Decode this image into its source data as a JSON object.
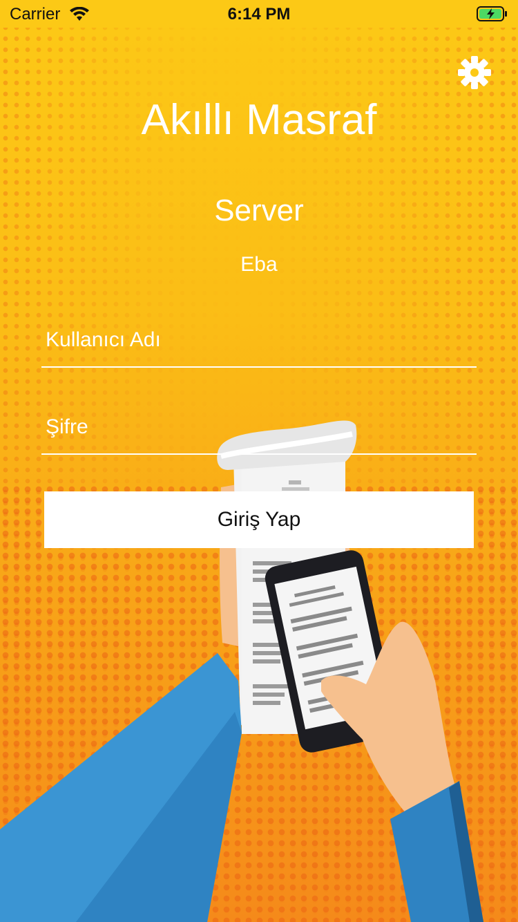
{
  "status_bar": {
    "carrier": "Carrier",
    "time": "6:14 PM",
    "wifi_icon": "wifi-icon",
    "battery_icon": "battery-charging-icon"
  },
  "header": {
    "settings_icon": "gear-icon",
    "app_title": "Akıllı Masraf"
  },
  "server": {
    "label": "Server",
    "name": "Eba"
  },
  "form": {
    "username_placeholder": "Kullanıcı Adı",
    "password_placeholder": "Şifre",
    "login_label": "Giriş Yap"
  },
  "colors": {
    "background_top": "#fcc916",
    "background_bottom": "#f58a1a",
    "text": "#ffffff",
    "button_bg": "#ffffff",
    "sleeve_blue": "#3b95d3",
    "skin": "#f6c08e",
    "battery_green": "#4cd964"
  },
  "illustration": "hand-holding-receipt-and-phone-illustration"
}
